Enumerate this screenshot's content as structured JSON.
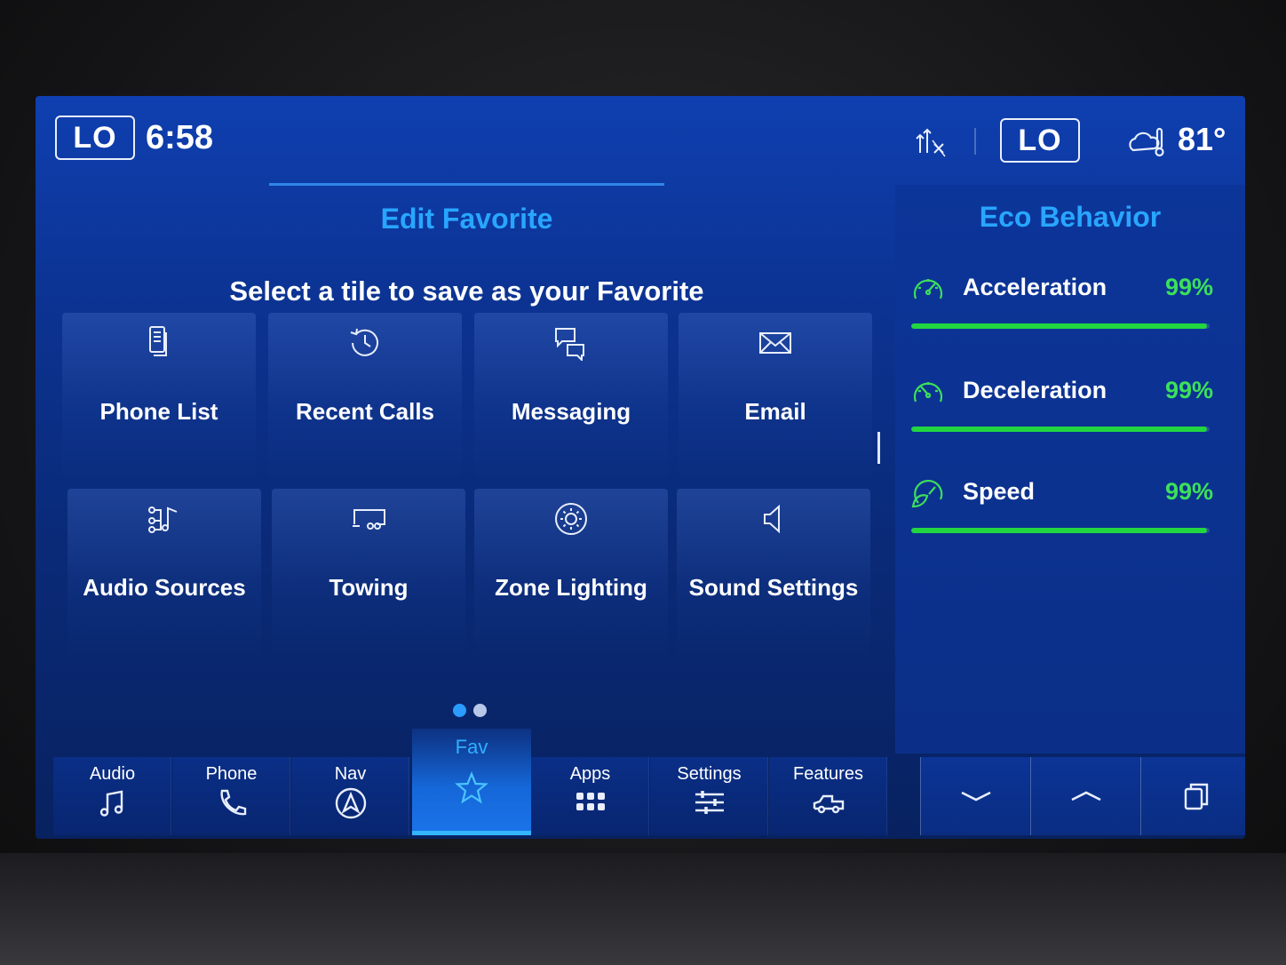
{
  "status_bar": {
    "left_climate": "LO",
    "clock": "6:58",
    "right_climate": "LO",
    "outside_temp": "81°",
    "icons": [
      "sync-signal-icon",
      "weather-icon"
    ]
  },
  "favorites": {
    "title": "Edit Favorite",
    "subtitle": "Select a tile to save as your Favorite",
    "tiles": [
      {
        "label": "Phone List",
        "icon": "phone-list-icon"
      },
      {
        "label": "Recent Calls",
        "icon": "clock-history-icon"
      },
      {
        "label": "Messaging",
        "icon": "chat-bubbles-icon"
      },
      {
        "label": "Email",
        "icon": "envelope-icon"
      },
      {
        "label": "Audio Sources",
        "icon": "audio-sources-icon"
      },
      {
        "label": "Towing",
        "icon": "trailer-icon"
      },
      {
        "label": "Zone Lighting",
        "icon": "zone-lighting-icon"
      },
      {
        "label": "Sound Settings",
        "icon": "speaker-icon"
      }
    ],
    "pagination": {
      "current": 1,
      "total": 2
    }
  },
  "eco": {
    "title": "Eco Behavior",
    "metrics": [
      {
        "label": "Acceleration",
        "value": "99%",
        "level": 0.99
      },
      {
        "label": "Deceleration",
        "value": "99%",
        "level": 0.99
      },
      {
        "label": "Speed",
        "value": "99%",
        "level": 0.99
      }
    ],
    "accent": "#22d640"
  },
  "nav": {
    "items": [
      {
        "label": "Audio",
        "icon": "music-note-icon"
      },
      {
        "label": "Phone",
        "icon": "phone-icon"
      },
      {
        "label": "Nav",
        "icon": "navigation-icon"
      },
      {
        "label": "Fav",
        "icon": "star-icon",
        "active": true
      },
      {
        "label": "Apps",
        "icon": "apps-grid-icon"
      },
      {
        "label": "Settings",
        "icon": "sliders-icon"
      },
      {
        "label": "Features",
        "icon": "truck-icon"
      }
    ],
    "controls": [
      "chevron-down-icon",
      "chevron-up-icon",
      "window-stack-icon"
    ]
  },
  "colors": {
    "accent_blue": "#28a6ff",
    "eco_green": "#3ce05a"
  }
}
